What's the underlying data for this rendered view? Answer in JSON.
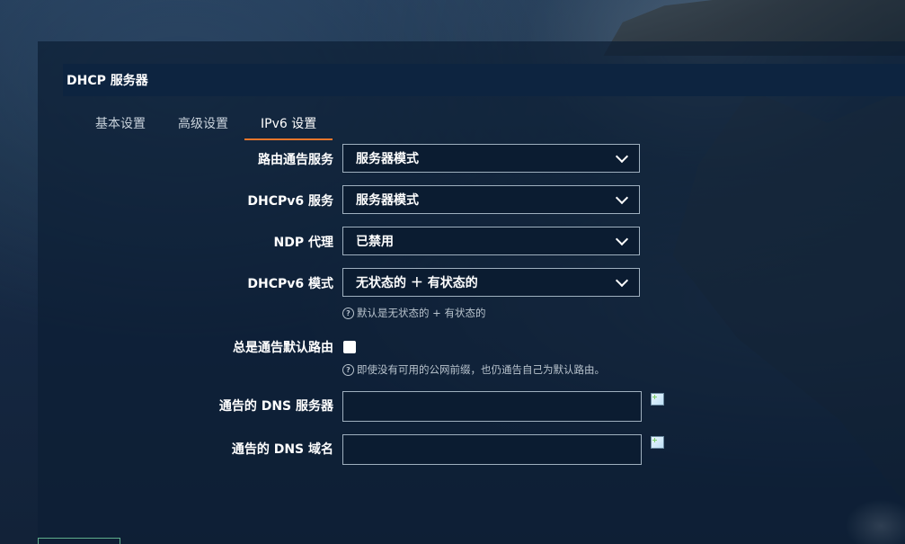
{
  "panel": {
    "title": "DHCP 服务器"
  },
  "tabs": [
    {
      "label": "基本设置",
      "active": false
    },
    {
      "label": "高级设置",
      "active": false
    },
    {
      "label": "IPv6 设置",
      "active": true
    }
  ],
  "form": {
    "ra_service": {
      "label": "路由通告服务",
      "value": "服务器模式"
    },
    "dhcpv6_service": {
      "label": "DHCPv6 服务",
      "value": "服务器模式"
    },
    "ndp_proxy": {
      "label": "NDP 代理",
      "value": "已禁用"
    },
    "dhcpv6_mode": {
      "label": "DHCPv6 模式",
      "value": "无状态的 ＋ 有状态的",
      "hint": "默认是无状态的 + 有状态的"
    },
    "always_default_route": {
      "label": "总是通告默认路由",
      "checked": false,
      "hint": "即使没有可用的公网前缀，也仍通告自己为默认路由。"
    },
    "announced_dns_servers": {
      "label": "通告的 DNS 服务器",
      "value": ""
    },
    "announced_dns_domains": {
      "label": "通告的 DNS 域名",
      "value": ""
    }
  },
  "icons": {
    "help": "help-circle-icon",
    "add": "add-item-icon",
    "dropdown": "chevron-down-icon"
  },
  "colors": {
    "tab_accent": "#e8762c",
    "header_bg": "#0d2440"
  }
}
